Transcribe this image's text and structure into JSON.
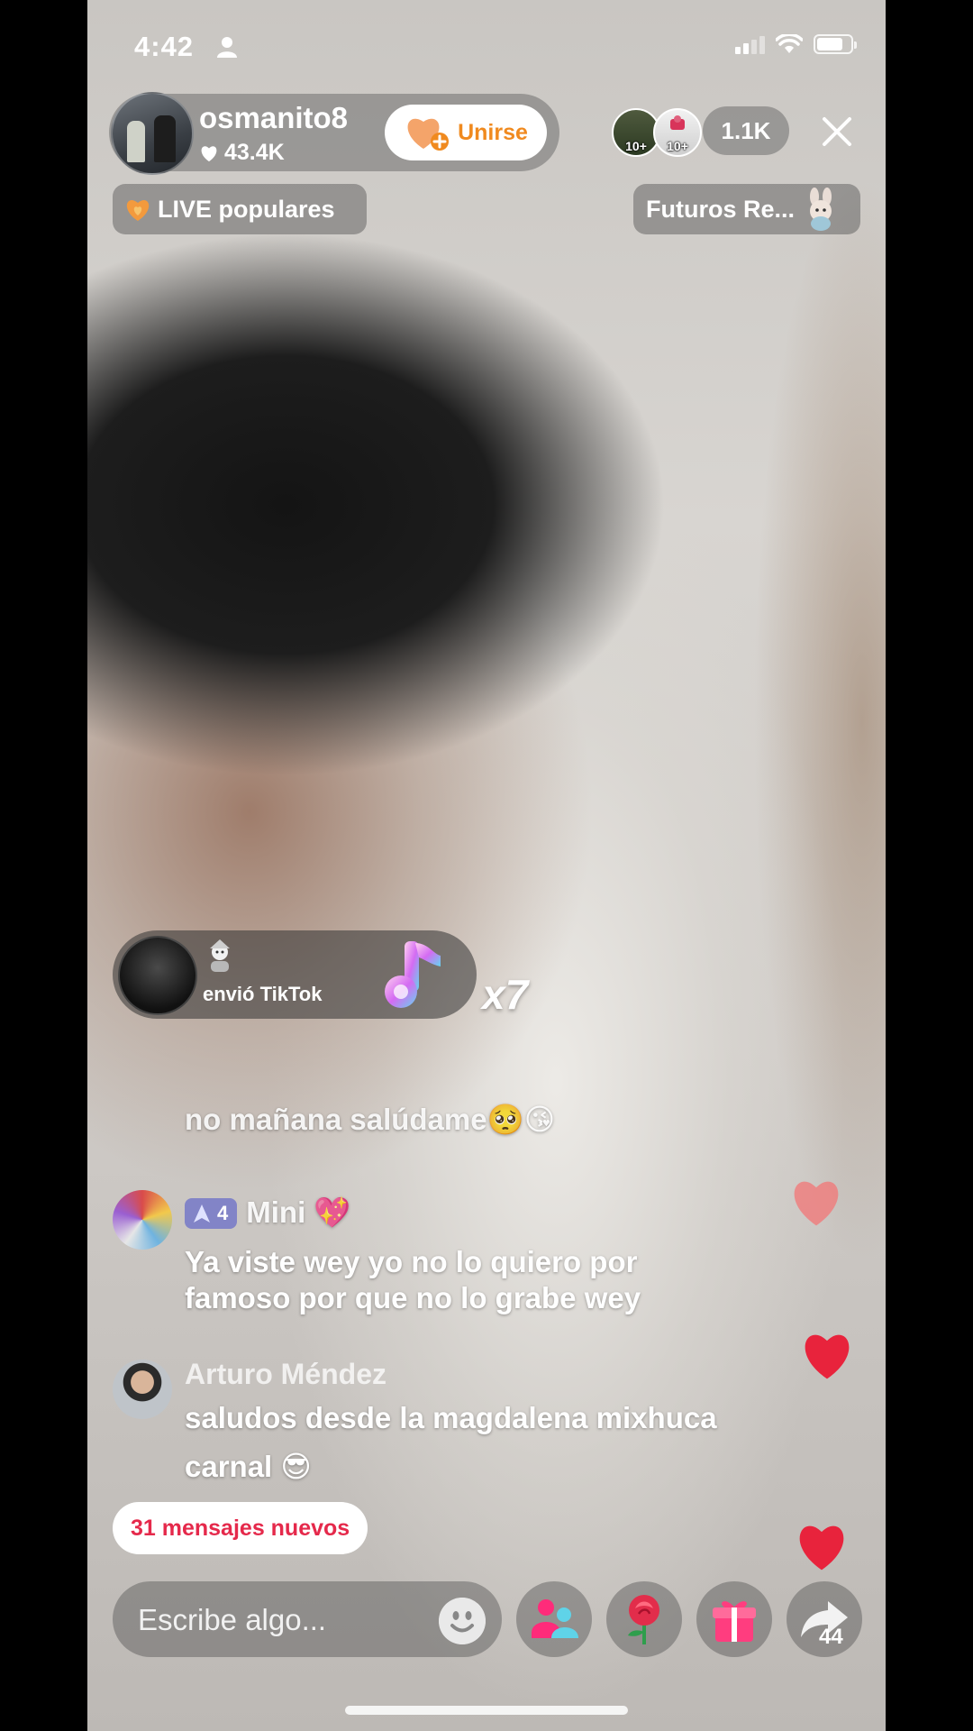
{
  "status_bar": {
    "time": "4:42"
  },
  "host": {
    "name": "osmanito8",
    "likes": "43.4K",
    "join_label": "Unirse"
  },
  "viewers": {
    "badge1": "10+",
    "badge2": "10+",
    "count": "1.1K"
  },
  "tags": {
    "live": "LIVE populares",
    "futuros": "Futuros Re..."
  },
  "gift": {
    "text": "envió TikTok",
    "count": "x7"
  },
  "chat": {
    "faded": "no mañana salúdame🥺😘",
    "mini": {
      "level": "4",
      "name": "Mini 💖",
      "message": "Ya viste wey yo no lo quiero por famoso por que no lo grabe wey"
    },
    "arturo": {
      "name": "Arturo Méndez",
      "message": "saludos desde la magdalena mixhuca carnal 😎"
    }
  },
  "new_messages": "31 mensajes nuevos",
  "input": {
    "placeholder": "Escribe algo..."
  },
  "share": {
    "count": "44"
  },
  "colors": {
    "join_accent": "#f08a1f",
    "new_messages": "#e5294b",
    "heart": "#e8233c",
    "level_badge": "#6a6ec8"
  }
}
